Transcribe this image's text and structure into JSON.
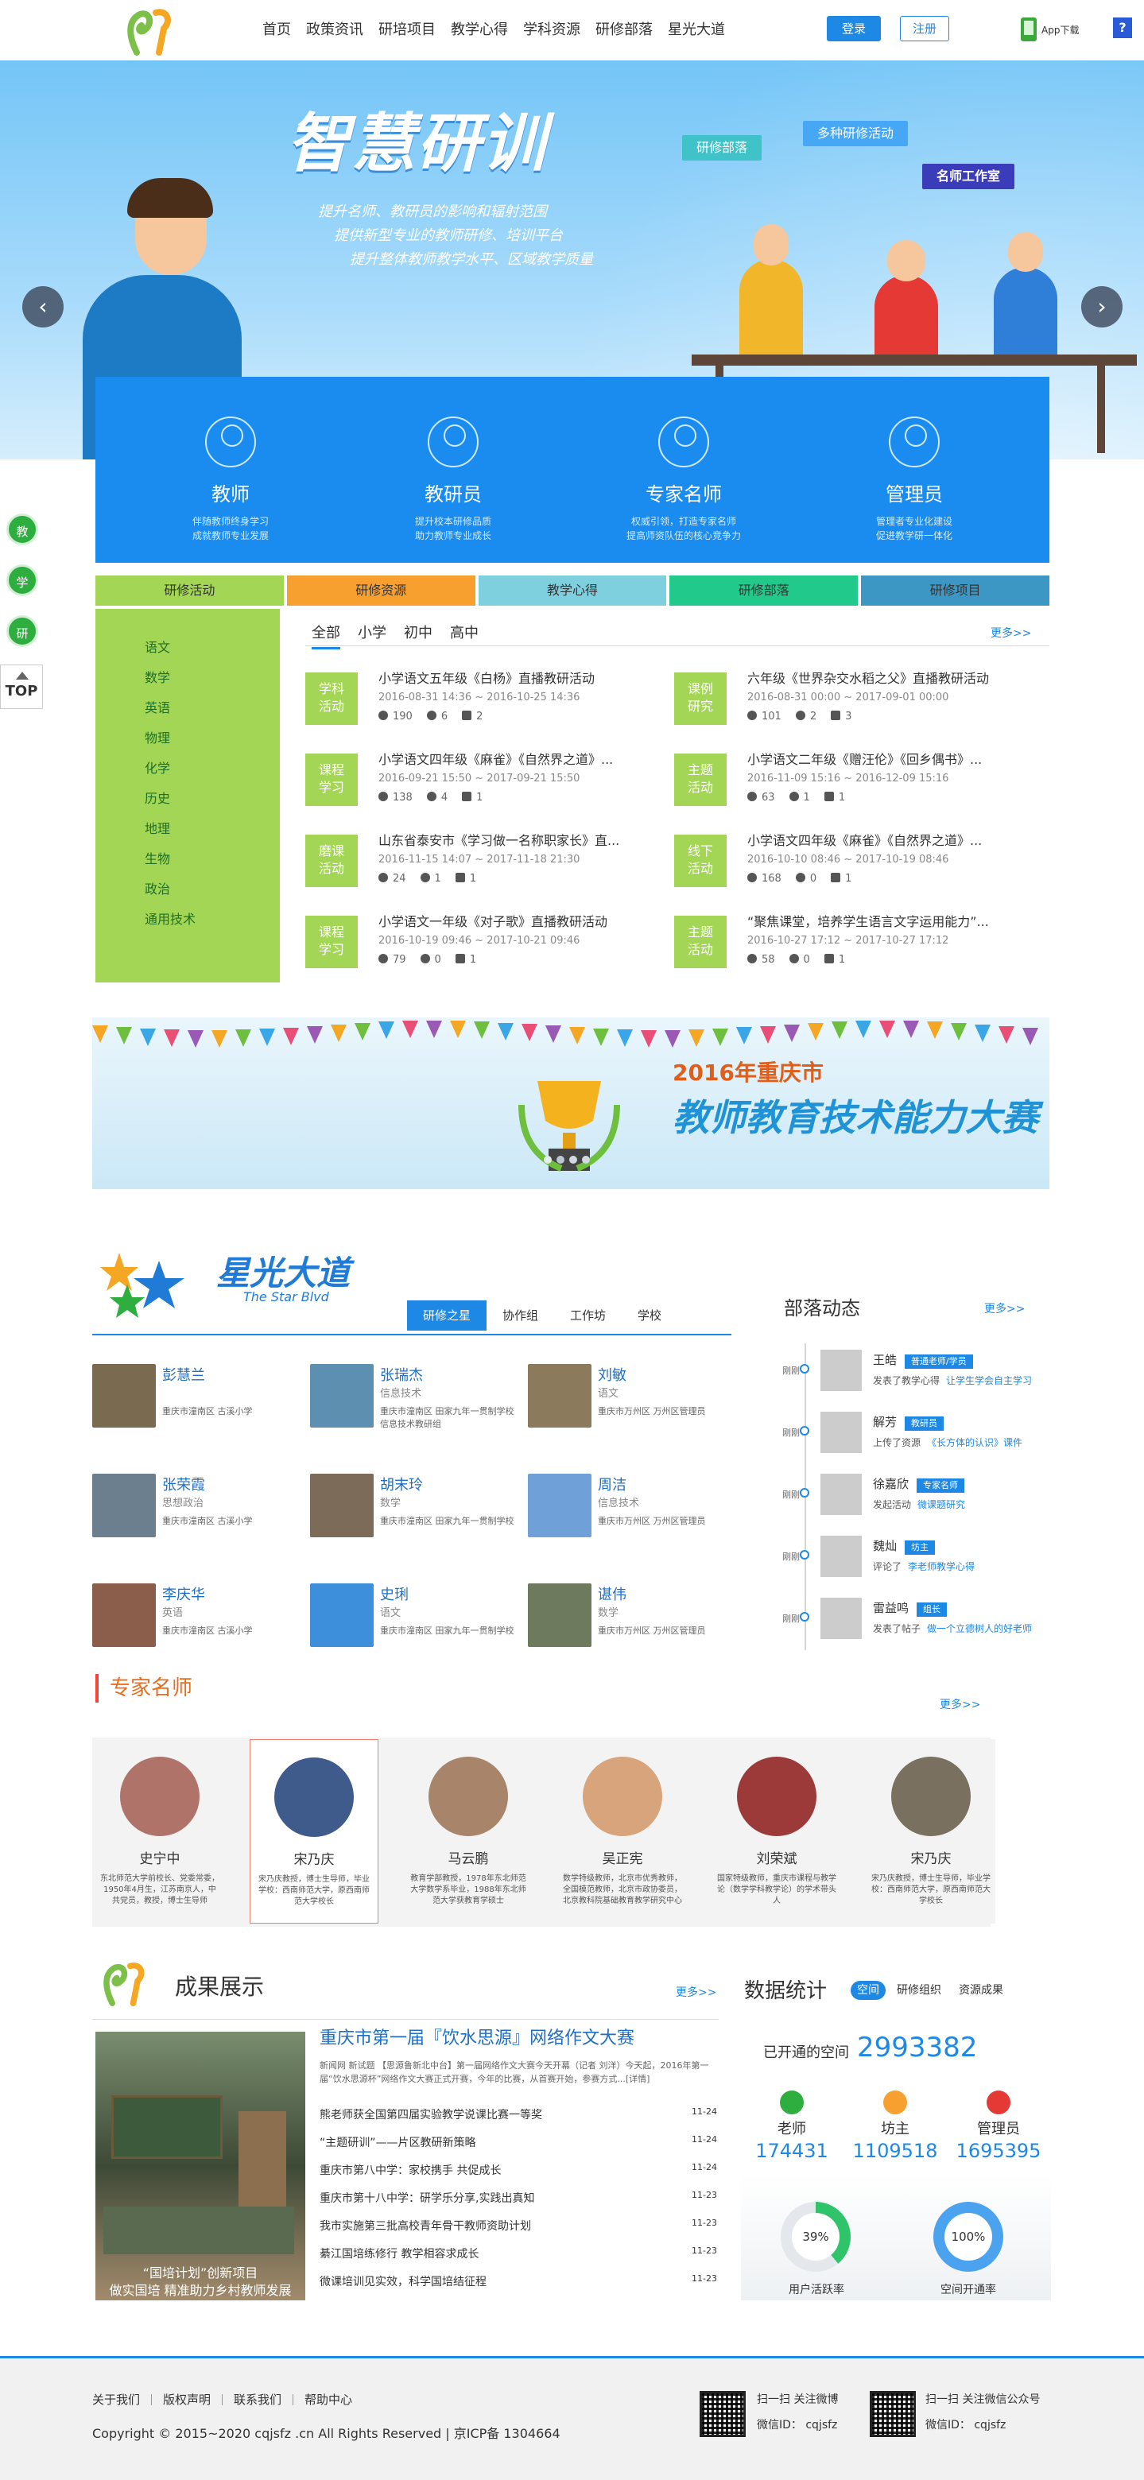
{
  "header": {
    "nav": [
      "首页",
      "政策资讯",
      "研培项目",
      "教学心得",
      "学科资源",
      "研修部落",
      "星光大道"
    ],
    "login": "登录",
    "register": "注册",
    "app_download": "App下载",
    "help_icon": "?"
  },
  "banner": {
    "title": "智慧研训",
    "lines": [
      "提升名师、教研员的影响和辐射范围",
      "提供新型专业的教师研修、培训平台",
      "提升整体教师教学水平、区域教学质量"
    ],
    "tags": [
      "研修部落",
      "多种研修活动",
      "名师工作室"
    ],
    "prev_arrow": "‹",
    "next_arrow": "›"
  },
  "roles": [
    {
      "name": "教师",
      "desc1": "伴随教师终身学习",
      "desc2": "成就教师专业发展"
    },
    {
      "name": "教研员",
      "desc1": "提升校本研修品质",
      "desc2": "助力教师专业成长"
    },
    {
      "name": "专家名师",
      "desc1": "权威引领，打造专家名师",
      "desc2": "提高师资队伍的核心竞争力"
    },
    {
      "name": "管理员",
      "desc1": "管理者专业化建设",
      "desc2": "促进教学研一体化"
    }
  ],
  "side_float": {
    "items": [
      "教",
      "学",
      "研"
    ],
    "top": "TOP"
  },
  "tabs": [
    {
      "label": "研修活动",
      "color": "#a3d654"
    },
    {
      "label": "研修资源",
      "color": "#f7a030"
    },
    {
      "label": "教学心得",
      "color": "#7fd0df"
    },
    {
      "label": "研修部落",
      "color": "#21c98b"
    },
    {
      "label": "研修项目",
      "color": "#3c97c4"
    }
  ],
  "subjects": [
    "语文",
    "数学",
    "英语",
    "物理",
    "化学",
    "历史",
    "地理",
    "生物",
    "政治",
    "通用技术"
  ],
  "levels": [
    "全部",
    "小学",
    "初中",
    "高中"
  ],
  "more": "更多>>",
  "activities": [
    {
      "badge1": "学科",
      "badge2": "活动",
      "title": "小学语文五年级《白杨》直播教研活动",
      "date": "2016-08-31 14:36 ~ 2016-10-25 14:36",
      "views": "190",
      "comments": "6",
      "docs": "2"
    },
    {
      "badge1": "课例",
      "badge2": "研究",
      "title": "六年级《世界杂交水稻之父》直播教研活动",
      "date": "2016-08-31 00:00 ~ 2017-09-01 00:00",
      "views": "101",
      "comments": "2",
      "docs": "3"
    },
    {
      "badge1": "课程",
      "badge2": "学习",
      "title": "小学语文四年级《麻雀》《自然界之道》...",
      "date": "2016-09-21 15:50 ~ 2017-09-21 15:50",
      "views": "138",
      "comments": "4",
      "docs": "1"
    },
    {
      "badge1": "主题",
      "badge2": "活动",
      "title": "小学语文二年级《赠汪伦》《回乡偶书》...",
      "date": "2016-11-09 15:16 ~ 2016-12-09 15:16",
      "views": "63",
      "comments": "1",
      "docs": "1"
    },
    {
      "badge1": "磨课",
      "badge2": "活动",
      "title": "山东省泰安市《学习做一名称职家长》直...",
      "date": "2016-11-15 14:07 ~ 2017-11-18 21:30",
      "views": "24",
      "comments": "1",
      "docs": "1"
    },
    {
      "badge1": "线下",
      "badge2": "活动",
      "title": "小学语文四年级《麻雀》《自然界之道》...",
      "date": "2016-10-10 08:46 ~ 2017-10-19 08:46",
      "views": "168",
      "comments": "0",
      "docs": "1"
    },
    {
      "badge1": "课程",
      "badge2": "学习",
      "title": "小学语文一年级《对子歌》直播教研活动",
      "date": "2016-10-19 09:46 ~ 2017-10-21 09:46",
      "views": "79",
      "comments": "0",
      "docs": "1"
    },
    {
      "badge1": "主题",
      "badge2": "活动",
      "title": "“聚焦课堂，培养学生语言文字运用能力”...",
      "date": "2016-10-27 17:12 ~ 2017-10-27 17:12",
      "views": "58",
      "comments": "0",
      "docs": "1"
    }
  ],
  "ad": {
    "year": "2016年重庆市",
    "title": "教师教育技术能力大赛"
  },
  "star": {
    "title": "星光大道",
    "subtitle": "The Star Blvd",
    "tabs": [
      "研修之星",
      "协作组",
      "工作坊",
      "学校"
    ],
    "people": [
      {
        "name": "彭慧兰",
        "role": "",
        "school": "重庆市潼南区 古溪小学"
      },
      {
        "name": "张瑞杰",
        "role": "信息技术",
        "school": "重庆市潼南区 田家九年一贯制学校 信息技术教研组"
      },
      {
        "name": "刘敏",
        "role": "语文",
        "school": "重庆市万州区 万州区管理员"
      },
      {
        "name": "张荣霞",
        "role": "思想政治",
        "school": "重庆市潼南区 古溪小学"
      },
      {
        "name": "胡末玲",
        "role": "数学",
        "school": "重庆市潼南区 田家九年一贯制学校"
      },
      {
        "name": "周洁",
        "role": "信息技术",
        "school": "重庆市万州区 万州区管理员"
      },
      {
        "name": "李庆华",
        "role": "英语",
        "school": "重庆市潼南区 古溪小学"
      },
      {
        "name": "史琍",
        "role": "语文",
        "school": "重庆市潼南区 田家九年一贯制学校"
      },
      {
        "name": "谌伟",
        "role": "数学",
        "school": "重庆市万州区 万州区管理员"
      }
    ]
  },
  "tribe": {
    "title": "部落动态",
    "time_label": "刚刚",
    "items": [
      {
        "name": "王皓",
        "badge": "普通老师/学员",
        "action": "发表了教学心得",
        "link": "让学生学会自主学习"
      },
      {
        "name": "解芳",
        "badge": "教研员",
        "action": "上传了资源",
        "link": "《长方体的认识》课件"
      },
      {
        "name": "徐嘉欣",
        "badge": "专家名师",
        "action": "发起活动",
        "link": "微课题研究"
      },
      {
        "name": "魏灿",
        "badge": "坊主",
        "action": "评论了",
        "link": "李老师教学心得"
      },
      {
        "name": "雷益鸣",
        "badge": "组长",
        "action": "发表了帖子",
        "link": "做一个立德树人的好老师"
      }
    ]
  },
  "experts": {
    "title": "专家名师",
    "items": [
      {
        "name": "史宁中",
        "desc": "东北师范大学前校长、党委常委，1950年4月生，江苏南京人，中共党员，教授，博士生导师"
      },
      {
        "name": "宋乃庆",
        "desc": "宋乃庆教授，博士生导师，毕业学校：西南师范大学，原西南师范大学校长"
      },
      {
        "name": "马云鹏",
        "desc": "教育学部教授，1978年东北师范大学数学系毕业，1988年东北师范大学获教育学硕士"
      },
      {
        "name": "吴正宪",
        "desc": "数学特级教师，北京市优秀教师，全国模范教师，北京市政协委员，北京教科院基础教育教学研究中心"
      },
      {
        "name": "刘荣斌",
        "desc": "国家特级教师，重庆市课程与教学论（数学学科教学论）的学术带头人"
      },
      {
        "name": "宋乃庆",
        "desc": "宋乃庆教授，博士生导师，毕业学校：西南师范大学，原西南师范大学校长"
      }
    ]
  },
  "achievements": {
    "title": "成果展示",
    "photo_caption1": "“国培计划”创新项目",
    "photo_caption2": "做实国培 精准助力乡村教师发展",
    "headline": "重庆市第一届『饮水思源』网络作文大赛",
    "desc": "新闻网 新试题 【思源鲁新北中台】第一届网络作文大赛今天开幕（记者 刘洋）今天起，2016年第一届“饮水思源杯”网络作文大赛正式开赛，今年的比赛，从首赛开始，参赛方式...[详情]",
    "news": [
      {
        "title": "熊老师获全国第四届实验教学说课比赛一等奖",
        "date": "11-24"
      },
      {
        "title": "“主题研训”——片区教研新策略",
        "date": "11-24"
      },
      {
        "title": "重庆市第八中学：家校携手 共促成长",
        "date": "11-24"
      },
      {
        "title": "重庆市第十八中学：研学乐分享,实践出真知",
        "date": "11-23"
      },
      {
        "title": "我市实施第三批高校青年骨干教师资助计划",
        "date": "11-23"
      },
      {
        "title": "綦江国培练修行 教学相容求成长",
        "date": "11-23"
      },
      {
        "title": "微课培训见实效，科学国培结征程",
        "date": "11-23"
      }
    ]
  },
  "stats": {
    "title": "数据统计",
    "tabs": [
      "空间",
      "研修组织",
      "资源成果"
    ],
    "space_label": "已开通的空间",
    "space_value": "2993382",
    "cols": [
      {
        "label": "老师",
        "value": "174431",
        "color": "#2fae40"
      },
      {
        "label": "坊主",
        "value": "1109518",
        "color": "#f7a030"
      },
      {
        "label": "管理员",
        "value": "1695395",
        "color": "#e53935"
      }
    ],
    "rings": [
      {
        "value": "39%",
        "label": "用户活跃率",
        "color": "#2fc46a",
        "pct": 0.39
      },
      {
        "value": "100%",
        "label": "空间开通率",
        "color": "#4ba3f0",
        "pct": 1.0
      }
    ]
  },
  "footer": {
    "links": [
      "关于我们",
      "版权声明",
      "联系我们",
      "帮助中心"
    ],
    "copyright": "Copyright © 2015~2020 cqjsfz .cn All Rights Reserved | 京ICP备 1304664",
    "qr1_text1": "扫一扫 关注微博",
    "qr1_text2": "微信ID： cqjsfz",
    "qr2_text1": "扫一扫 关注微信公众号",
    "qr2_text2": "微信ID： cqjsfz"
  }
}
